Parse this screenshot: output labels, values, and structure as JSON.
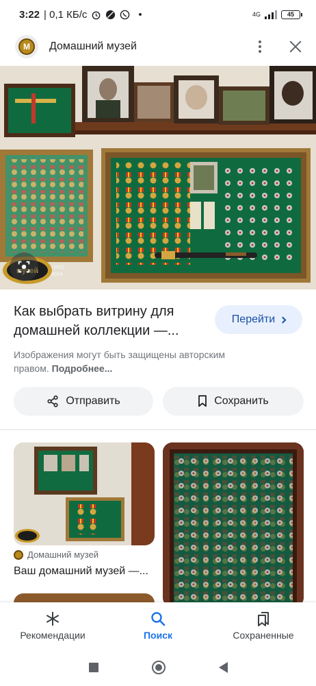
{
  "status_bar": {
    "time": "3:22",
    "network_speed": "| 0,1 КБ/с",
    "indicator_dot": "•",
    "network_type": "4G",
    "battery": "45"
  },
  "header": {
    "logo_letter": "М",
    "title": "Домашний музей"
  },
  "main_image": {
    "watermark": "ТЕ 8 PRO\nCAMERA",
    "logo_text": "музей"
  },
  "result": {
    "title": "Как выбрать витрину для домашней коллекции —...",
    "go_button": "Перейти",
    "copyright_text": "Изображения могут быть защищены авторским правом.",
    "copyright_more": "Подробнее..."
  },
  "actions": {
    "share": "Отправить",
    "save": "Сохранить"
  },
  "related": {
    "source": "Домашний музей",
    "title": "Ваш домашний музей —..."
  },
  "bottom_nav": {
    "items": [
      {
        "label": "Рекомендации",
        "icon": "asterisk-icon"
      },
      {
        "label": "Поиск",
        "icon": "search-icon"
      },
      {
        "label": "Сохраненные",
        "icon": "bookmarks-icon"
      }
    ],
    "active": "Поиск"
  },
  "colors": {
    "accent": "#1a73e8",
    "button_bg": "#f1f3f4",
    "go_bg": "#e8f0fe",
    "frame_green": "#0f6b3f",
    "frame_gold": "#a07838"
  }
}
